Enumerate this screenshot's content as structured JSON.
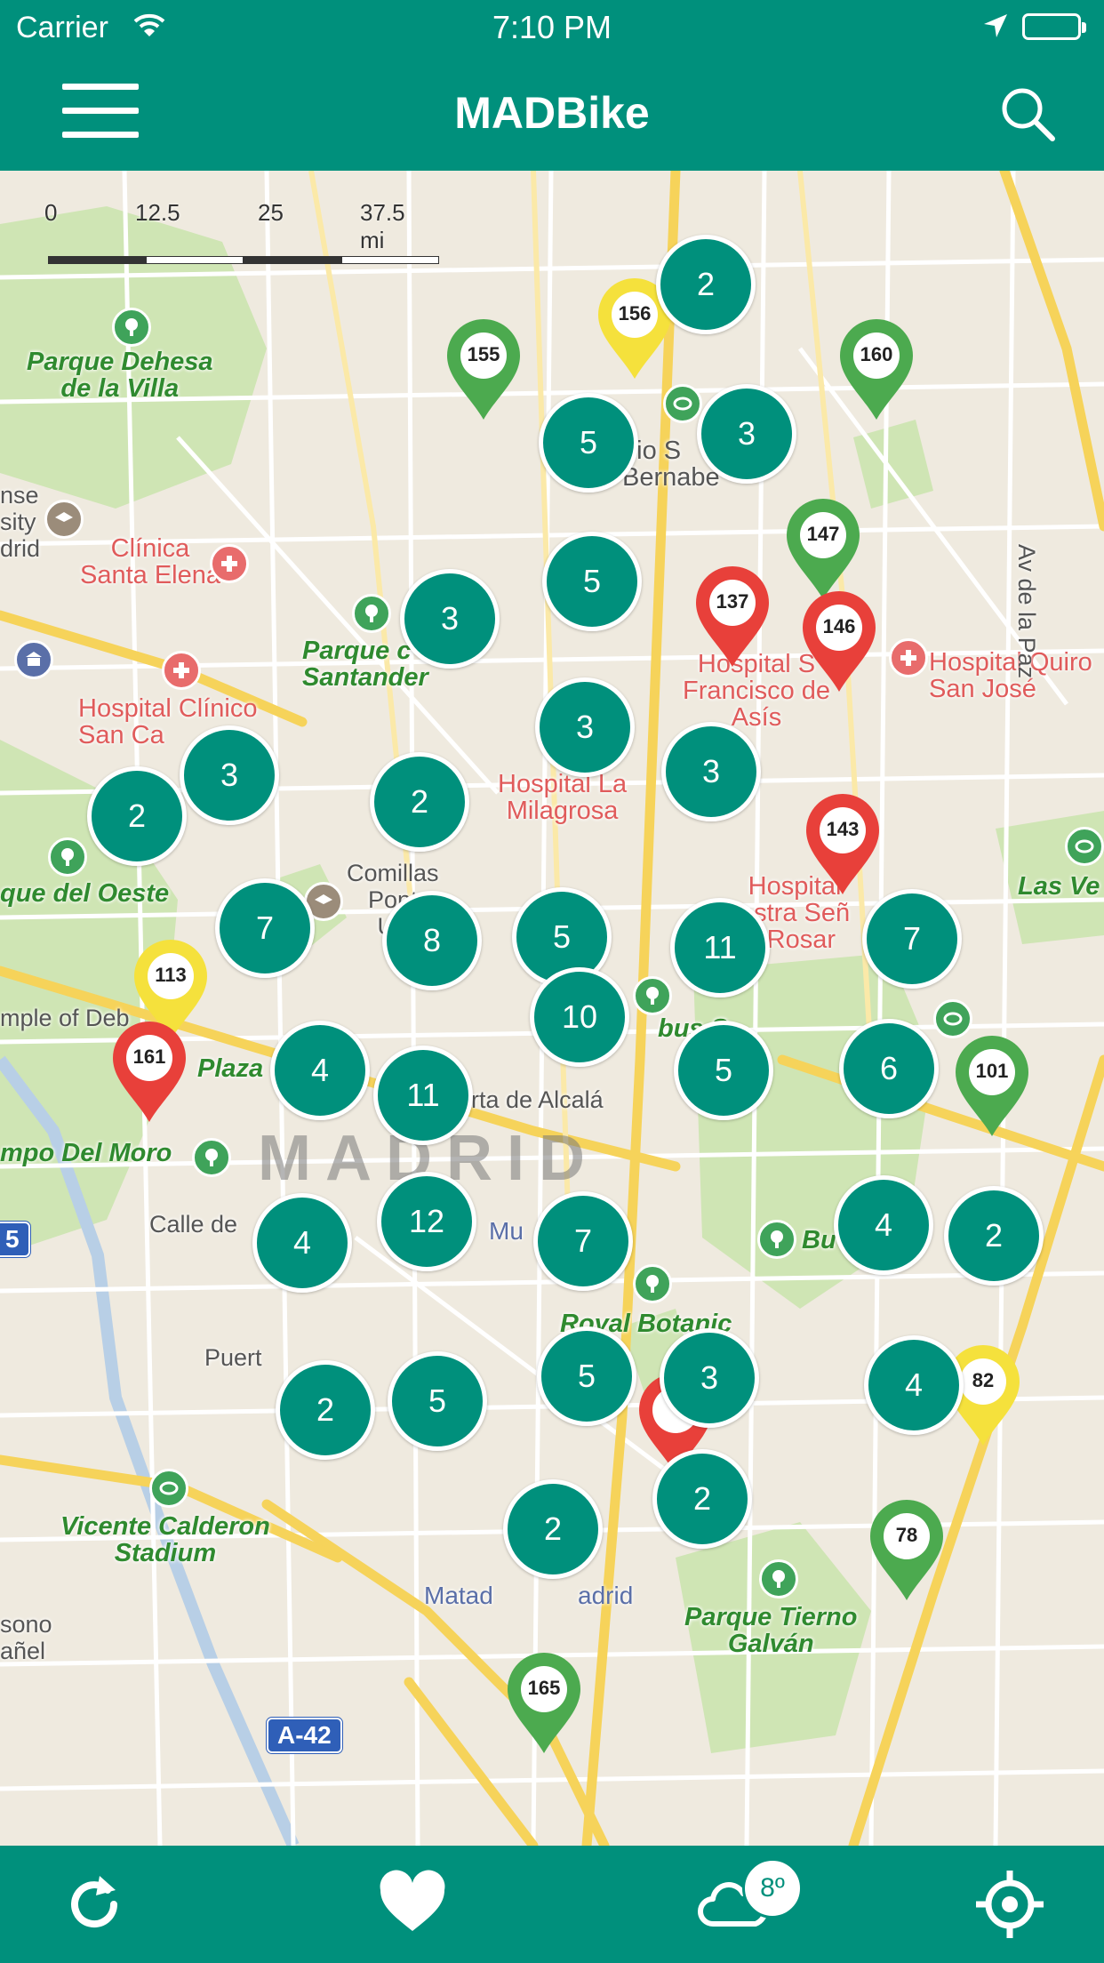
{
  "status_bar": {
    "carrier": "Carrier",
    "time": "7:10 PM",
    "icons": [
      "wifi-icon",
      "location-arrow-icon",
      "battery-icon"
    ]
  },
  "header": {
    "title": "MADBike",
    "menu_icon": "hamburger-menu-icon",
    "search_icon": "search-icon",
    "background": "#00907c"
  },
  "map": {
    "city_name": "MADRID",
    "scale_labels": [
      "0",
      "12.5",
      "25",
      "37.5 mi"
    ],
    "labels": {
      "parque_dehesa": "Parque Dehesa\nde la Villa",
      "ense_sity_drid": "nse\nsity\ndrid",
      "clinica_santa_elena": "Clínica\nSanta Elena",
      "hospital_clinico": "Hospital Clínico\nSan Ca",
      "parque_santander": "Parque c\nSantander",
      "estadio": "dio S\nBernabe",
      "hospital_san_francisco": "Hospital S\nFrancisco de\nAsís",
      "hospital_quiron": "Hospital Quiro\nSan José",
      "hospital_milagrosa": "Hospital La\nMilagrosa",
      "parque_oeste": "que del Oeste",
      "comillas": "Comillas\nPont\nUn",
      "hospital_rosario": "Hospital\nostra Señ\nl Rosar",
      "las_ventas": "Las Ve",
      "temple_debod": "mple of Deb",
      "plaza": "Plaza",
      "campo_moro": "mpo Del Moro",
      "puerta_alcala": "uerta de Alcalá",
      "cibeles": "bus S",
      "calle_de": "Calle de",
      "museo": "Mu",
      "buen_retiro": "Bu",
      "royal_botanic": "Royal Botanic",
      "puerta": "Puert",
      "vicente_calderon": "Vicente Calderon\nStadium",
      "matadero": "Matad",
      "madrid_suffix": "adrid",
      "parque_tierno": "Parque Tierno\nGalván",
      "sono": "sono\nañel",
      "av_dela_paz": "Av de la Paz",
      "a42": "A-42",
      "m30_left": "5",
      "m30_right": "A"
    }
  },
  "clusters": [
    {
      "count": "2"
    },
    {
      "count": "5"
    },
    {
      "count": "3"
    },
    {
      "count": "5"
    },
    {
      "count": "3"
    },
    {
      "count": "3"
    },
    {
      "count": "3"
    },
    {
      "count": "3"
    },
    {
      "count": "2"
    },
    {
      "count": "2"
    },
    {
      "count": "7"
    },
    {
      "count": "8"
    },
    {
      "count": "5"
    },
    {
      "count": "11"
    },
    {
      "count": "7"
    },
    {
      "count": "10"
    },
    {
      "count": "4"
    },
    {
      "count": "11"
    },
    {
      "count": "5"
    },
    {
      "count": "6"
    },
    {
      "count": "12"
    },
    {
      "count": "4"
    },
    {
      "count": "7"
    },
    {
      "count": "4"
    },
    {
      "count": "2"
    },
    {
      "count": "5"
    },
    {
      "count": "3"
    },
    {
      "count": "2"
    },
    {
      "count": "5"
    },
    {
      "count": "4"
    },
    {
      "count": "2"
    },
    {
      "count": "2"
    }
  ],
  "pins": [
    {
      "label": "156",
      "color": "#f5e13c"
    },
    {
      "label": "155",
      "color": "#4caa4f"
    },
    {
      "label": "160",
      "color": "#4caa4f"
    },
    {
      "label": "147",
      "color": "#4caa4f"
    },
    {
      "label": "137",
      "color": "#e8403a"
    },
    {
      "label": "146",
      "color": "#e8403a"
    },
    {
      "label": "143",
      "color": "#e8403a"
    },
    {
      "label": "113",
      "color": "#f5e13c"
    },
    {
      "label": "161",
      "color": "#e8403a"
    },
    {
      "label": "101",
      "color": "#4caa4f"
    },
    {
      "label": "82",
      "color": "#f5e13c"
    },
    {
      "label": "78",
      "color": "#4caa4f"
    },
    {
      "label": "165",
      "color": "#4caa4f"
    },
    {
      "label": "",
      "color": "#e8403a"
    }
  ],
  "tab_bar": {
    "items": [
      {
        "icon": "refresh-icon"
      },
      {
        "icon": "heart-icon"
      },
      {
        "icon": "weather-cloud-icon",
        "badge": "8º"
      },
      {
        "icon": "locate-me-icon"
      }
    ]
  }
}
